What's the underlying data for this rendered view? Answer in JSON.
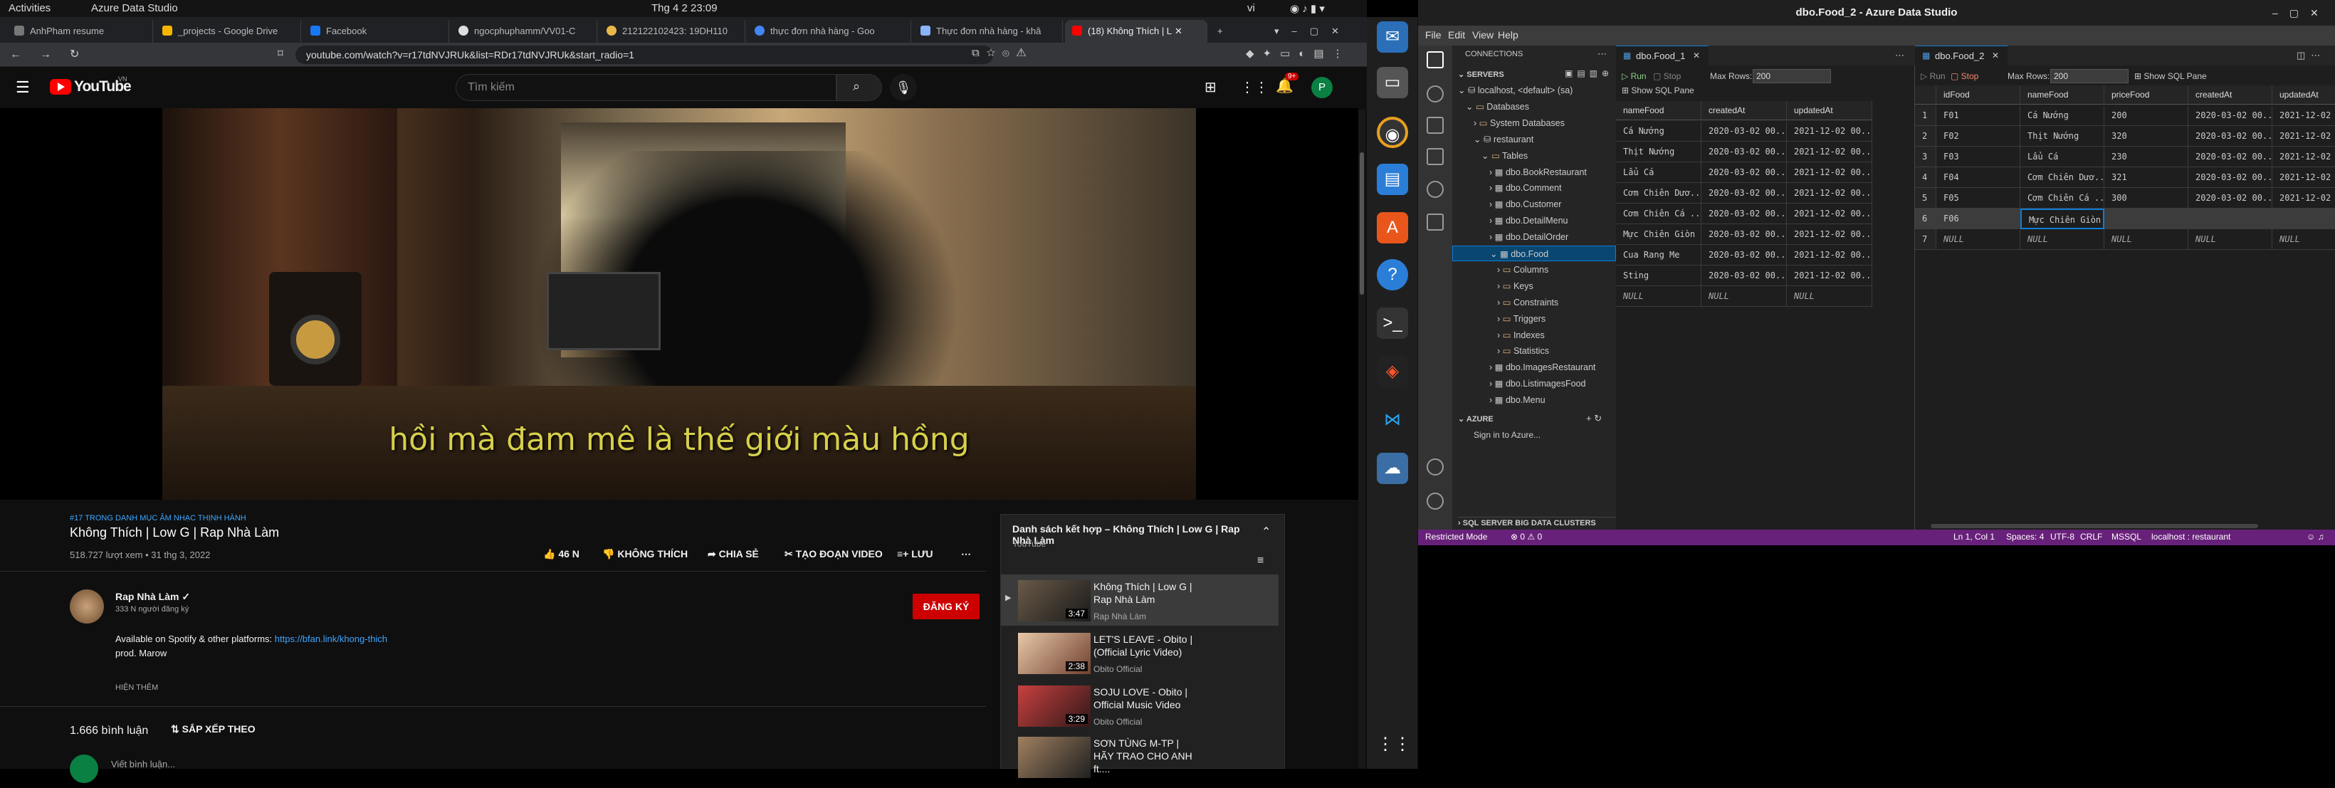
{
  "topbar": {
    "activities": "Activities",
    "app": "Azure Data Studio",
    "clock": "Thg 4 2  23:09",
    "lang": "vi"
  },
  "browser": {
    "tabs": [
      {
        "label": "AnhPham resume"
      },
      {
        "label": "_projects - Google Drive"
      },
      {
        "label": "Facebook"
      },
      {
        "label": "ngocphuphamm/VV01-C"
      },
      {
        "label": "212122102423: 19DH110"
      },
      {
        "label": "thực đơn nhà hàng - Goo"
      },
      {
        "label": "Thực đơn nhà hàng - khâ"
      },
      {
        "label": "(18) Không Thích | L"
      }
    ],
    "url": "youtube.com/watch?v=r17tdNVJRUk&list=RDr17tdNVJRUk&start_radio=1"
  },
  "youtube": {
    "logo": "YouTube",
    "region": "VN",
    "search_placeholder": "Tìm kiếm",
    "notif_count": "9+",
    "avatar_letter": "P",
    "subtitle": "hồi mà đam mê là thế giới màu hồng",
    "tag": "#17 TRONG DANH MỤC ÂM NHẠC THỊNH HÀNH",
    "title": "Không Thích | Low G | Rap Nhà Làm",
    "views": "518.727 lượt xem • 31 thg 3, 2022",
    "like": "46 N",
    "dislike": "KHÔNG THÍCH",
    "share": "CHIA SẺ",
    "clip": "TẠO ĐOẠN VIDEO",
    "save": "LƯU",
    "channel": "Rap Nhà Làm ✓",
    "subs": "333 N người đăng ký",
    "subscribe": "ĐĂNG KÝ",
    "desc1": "Available on Spotify & other platforms: ",
    "desc_link": "https://bfan.link/khong-thich",
    "desc2": "prod. Marow",
    "show_more": "HIỆN THÊM",
    "comment_count": "1.666 bình luận",
    "sort": "SẮP XẾP THEO",
    "comment_placeholder": "Viết bình luận...",
    "playlist": {
      "title": "Danh sách kết hợp – Không Thích | Low G | Rap Nhà Làm",
      "source": "YouTube",
      "items": [
        {
          "title": "Không Thích | Low G | Rap Nhà Làm",
          "channel": "Rap Nhà Làm",
          "duration": "3:47"
        },
        {
          "title": "LET'S LEAVE - Obito | (Official Lyric Video)",
          "channel": "Obito Official",
          "duration": "2:38"
        },
        {
          "title": "SOJU LOVE - Obito | Official Music Video",
          "channel": "Obito Official",
          "duration": "3:29"
        },
        {
          "title": "SƠN TÙNG M-TP | HÃY TRAO CHO ANH ft....",
          "channel": "",
          "duration": ""
        }
      ]
    }
  },
  "ads": {
    "window_title": "dbo.Food_2 - Azure Data Studio",
    "menu": [
      "File",
      "Edit",
      "View",
      "Help"
    ],
    "connections": "CONNECTIONS",
    "servers": "SERVERS",
    "tree": [
      {
        "label": "localhost, <default> (sa)",
        "indent": 0
      },
      {
        "label": "Databases",
        "indent": 1
      },
      {
        "label": "System Databases",
        "indent": 2
      },
      {
        "label": "restaurant",
        "indent": 2
      },
      {
        "label": "Tables",
        "indent": 3
      },
      {
        "label": "dbo.BookRestaurant",
        "indent": 4
      },
      {
        "label": "dbo.Comment",
        "indent": 4
      },
      {
        "label": "dbo.Customer",
        "indent": 4
      },
      {
        "label": "dbo.DetailMenu",
        "indent": 4
      },
      {
        "label": "dbo.DetailOrder",
        "indent": 4
      },
      {
        "label": "dbo.Food",
        "indent": 4
      },
      {
        "label": "Columns",
        "indent": 5
      },
      {
        "label": "Keys",
        "indent": 5
      },
      {
        "label": "Constraints",
        "indent": 5
      },
      {
        "label": "Triggers",
        "indent": 5
      },
      {
        "label": "Indexes",
        "indent": 5
      },
      {
        "label": "Statistics",
        "indent": 5
      },
      {
        "label": "dbo.ImagesRestaurant",
        "indent": 4
      },
      {
        "label": "dbo.ListimagesFood",
        "indent": 4
      },
      {
        "label": "dbo.Menu",
        "indent": 4
      }
    ],
    "azure": "AZURE",
    "azure_sign": "Sign in to Azure...",
    "bigdata": "SQL SERVER BIG DATA CLUSTERS",
    "editor1": {
      "tab": "dbo.Food_1",
      "run": "Run",
      "stop": "Stop",
      "max_rows_label": "Max Rows:",
      "max_rows": "200",
      "show_sql": "Show SQL Pane",
      "columns": [
        "nameFood",
        "createdAt",
        "updatedAt"
      ],
      "rows": [
        [
          "Cá Nướng",
          "2020-03-02 00...",
          "2021-12-02 00..."
        ],
        [
          "Thịt Nướng",
          "2020-03-02 00...",
          "2021-12-02 00..."
        ],
        [
          "Lẩu Cá",
          "2020-03-02 00...",
          "2021-12-02 00..."
        ],
        [
          "Cơm Chiên Dươ...",
          "2020-03-02 00...",
          "2021-12-02 00..."
        ],
        [
          "Cơm Chiên Cá ...",
          "2020-03-02 00...",
          "2021-12-02 00..."
        ],
        [
          "Mực Chiên Giòn",
          "2020-03-02 00...",
          "2021-12-02 00..."
        ],
        [
          "Cua Rang Me",
          "2020-03-02 00...",
          "2021-12-02 00..."
        ],
        [
          "Sting",
          "2020-03-02 00...",
          "2021-12-02 00..."
        ],
        [
          "NULL",
          "NULL",
          "NULL"
        ]
      ]
    },
    "editor2": {
      "tab": "dbo.Food_2",
      "run": "Run",
      "stop": "Stop",
      "max_rows_label": "Max Rows:",
      "max_rows": "200",
      "show_sql": "Show SQL Pane",
      "columns": [
        "idFood",
        "nameFood",
        "priceFood",
        "createdAt",
        "updatedAt"
      ],
      "rows": [
        [
          "1",
          "F01",
          "Cá Nướng",
          "200",
          "2020-03-02 00...",
          "2021-12-02"
        ],
        [
          "2",
          "F02",
          "Thịt Nướng",
          "320",
          "2020-03-02 00...",
          "2021-12-02"
        ],
        [
          "3",
          "F03",
          "Lẩu Cá",
          "230",
          "2020-03-02 00...",
          "2021-12-02"
        ],
        [
          "4",
          "F04",
          "Cơm Chiên Dươ...",
          "321",
          "2020-03-02 00...",
          "2021-12-02"
        ],
        [
          "5",
          "F05",
          "Cơm Chiên Cá ...",
          "300",
          "2020-03-02 00...",
          "2021-12-02"
        ],
        [
          "6",
          "F06",
          "Mực Chiên Giòn",
          "",
          "",
          ""
        ],
        [
          "7",
          "NULL",
          "NULL",
          "NULL",
          "NULL",
          "NULL"
        ]
      ]
    },
    "status": {
      "restricted": "Restricted Mode",
      "problems": "⊗ 0 ⚠ 0",
      "pos": "Ln 1, Col 1",
      "spaces": "Spaces: 4",
      "enc": "UTF-8",
      "eol": "CRLF",
      "lang": "MSSQL",
      "conn": "localhost : restaurant"
    }
  }
}
